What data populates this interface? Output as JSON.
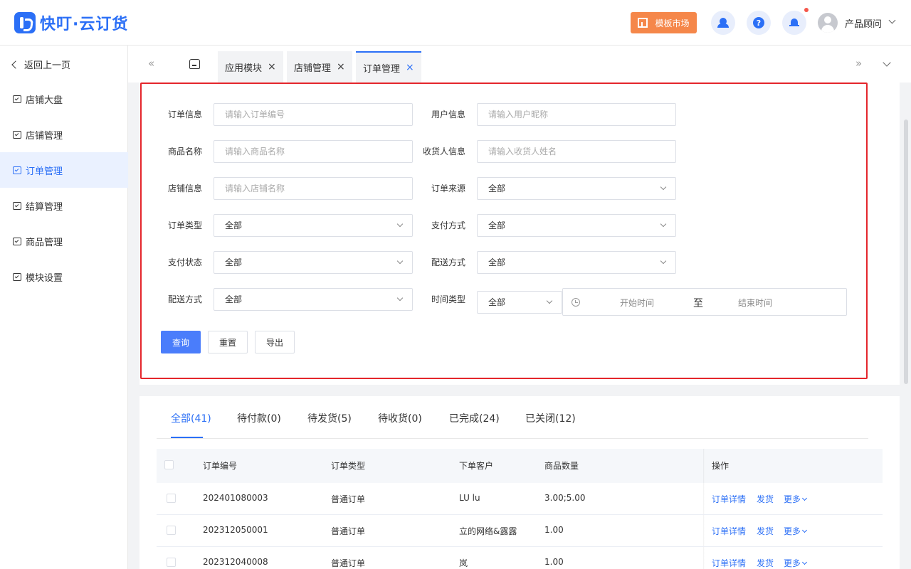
{
  "brand": {
    "name": "快叮·云订货",
    "color": "#2b6ff6"
  },
  "header": {
    "market_label": "模板市场",
    "icons": [
      "customer-service-icon",
      "help-icon",
      "bell-icon"
    ],
    "help_glyph": "?",
    "user_name": "产品顾问"
  },
  "sidebar": {
    "back_label": "返回上一页",
    "items": [
      {
        "label": "店铺大盘",
        "active": false
      },
      {
        "label": "店铺管理",
        "active": false
      },
      {
        "label": "订单管理",
        "active": true
      },
      {
        "label": "结算管理",
        "active": false
      },
      {
        "label": "商品管理",
        "active": false
      },
      {
        "label": "模块设置",
        "active": false
      }
    ]
  },
  "tabbar": {
    "prev_glyph": "«",
    "next_glyph": "»",
    "close_glyph": "×",
    "tabs": [
      {
        "label": "应用模块",
        "active": false
      },
      {
        "label": "店铺管理",
        "active": false
      },
      {
        "label": "订单管理",
        "active": true
      }
    ]
  },
  "filters": {
    "order_info": {
      "label": "订单信息",
      "placeholder": "请输入订单编号"
    },
    "user_info": {
      "label": "用户信息",
      "placeholder": "请输入用户昵称"
    },
    "product_name": {
      "label": "商品名称",
      "placeholder": "请输入商品名称"
    },
    "receiver_info": {
      "label": "收货人信息",
      "placeholder": "请输入收货人姓名"
    },
    "shop_info": {
      "label": "店铺信息",
      "placeholder": "请输入店铺名称"
    },
    "order_source": {
      "label": "订单来源",
      "value": "全部"
    },
    "order_type": {
      "label": "订单类型",
      "value": "全部"
    },
    "pay_method": {
      "label": "支付方式",
      "value": "全部"
    },
    "pay_status": {
      "label": "支付状态",
      "value": "全部"
    },
    "delivery_method_right": {
      "label": "配送方式",
      "value": "全部"
    },
    "delivery_method_left": {
      "label": "配送方式",
      "value": "全部"
    },
    "time_type": {
      "label": "时间类型",
      "value": "全部"
    },
    "date_range": {
      "start_placeholder": "开始时间",
      "separator": "至",
      "end_placeholder": "结束时间"
    }
  },
  "actions": {
    "query": "查询",
    "reset": "重置",
    "export": "导出"
  },
  "order_tabs": [
    {
      "label": "全部(41)",
      "active": true
    },
    {
      "label": "待付款(0)",
      "active": false
    },
    {
      "label": "待发货(5)",
      "active": false
    },
    {
      "label": "待收货(0)",
      "active": false
    },
    {
      "label": "已完成(24)",
      "active": false
    },
    {
      "label": "已关闭(12)",
      "active": false
    }
  ],
  "table": {
    "columns": [
      "订单编号",
      "订单类型",
      "下单客户",
      "商品数量",
      "操作"
    ],
    "rows": [
      {
        "order_no": "202401080003",
        "type": "普通订单",
        "customer": "LU lu",
        "qty": "3.00;5.00"
      },
      {
        "order_no": "202312050001",
        "type": "普通订单",
        "customer": "立的网络&露露",
        "qty": "1.00"
      },
      {
        "order_no": "202312040008",
        "type": "普通订单",
        "customer": "岚",
        "qty": "1.00"
      }
    ],
    "row_actions": {
      "detail": "订单详情",
      "ship": "发货",
      "more": "更多"
    }
  },
  "colors": {
    "accent": "#2b6ff6",
    "market": "#f5874a",
    "highlight_frame": "#e4262c",
    "primary_button": "#4a7dfb"
  }
}
